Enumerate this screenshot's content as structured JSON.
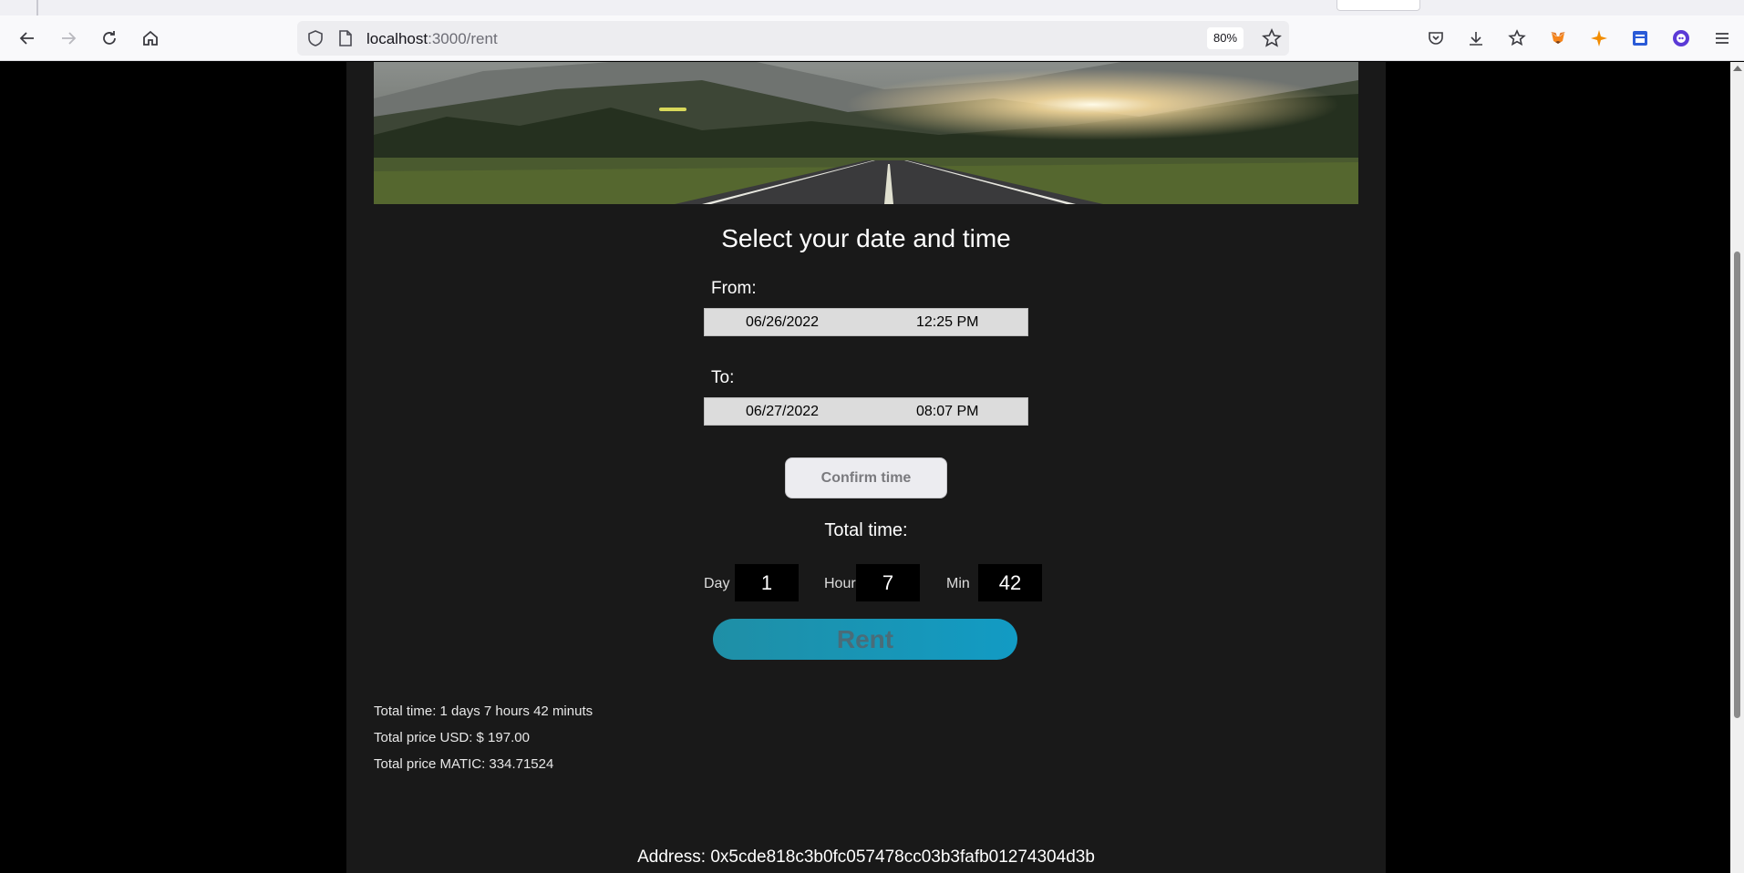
{
  "browser": {
    "url_host": "localhost",
    "url_path": ":3000/rent",
    "zoom": "80%",
    "icons": [
      "back-icon",
      "forward-icon",
      "reload-icon",
      "home-icon",
      "shield-icon",
      "page-icon",
      "bookmark-star-icon",
      "pocket-icon",
      "download-icon",
      "extensions-icon",
      "metamask-icon",
      "sparkle-extension-icon",
      "window-extension-icon",
      "profile-extension-icon",
      "menu-icon"
    ]
  },
  "page": {
    "title": "Select your date and time",
    "from": {
      "label": "From:",
      "date": "06/26/2022",
      "time": "12:25 PM"
    },
    "to": {
      "label": "To:",
      "date": "06/27/2022",
      "time": "08:07 PM"
    },
    "confirm_label": "Confirm time",
    "total_label": "Total time:",
    "duration": {
      "day_label": "Day",
      "day_value": "1",
      "hour_label": "Hour",
      "hour_value": "7",
      "min_label": "Min",
      "min_value": "42"
    },
    "rent_label": "Rent",
    "summary": {
      "total_time": "Total time: 1 days 7 hours 42 minuts",
      "price_usd": "Total price USD: $ 197.00",
      "price_matic": "Total price MATIC: 334.71524"
    },
    "address": "Address: 0x5cde818c3b0fc057478cc03b3fafb01274304d3b"
  },
  "colors": {
    "panel_bg": "#191919",
    "rent_button": "#129bc4",
    "page_bg": "#000000"
  }
}
